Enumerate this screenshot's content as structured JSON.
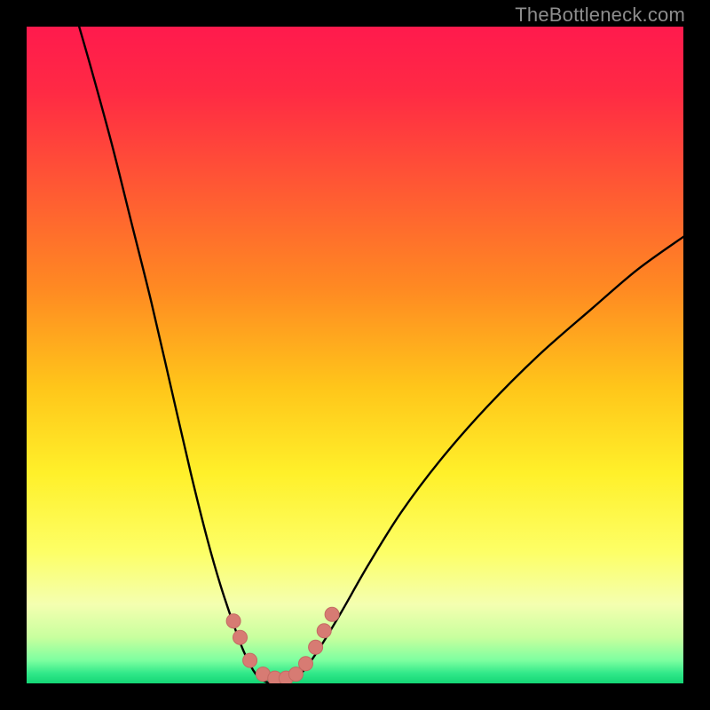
{
  "watermark": "TheBottleneck.com",
  "chart_data": {
    "type": "line",
    "title": "",
    "xlabel": "",
    "ylabel": "",
    "xlim": [
      0,
      100
    ],
    "ylim": [
      0,
      100
    ],
    "gradient_stops": [
      {
        "pos": 0.0,
        "color": "#ff1a4d"
      },
      {
        "pos": 0.1,
        "color": "#ff2a44"
      },
      {
        "pos": 0.25,
        "color": "#ff5a33"
      },
      {
        "pos": 0.4,
        "color": "#ff8a22"
      },
      {
        "pos": 0.55,
        "color": "#ffc61a"
      },
      {
        "pos": 0.68,
        "color": "#fff02a"
      },
      {
        "pos": 0.8,
        "color": "#fdff66"
      },
      {
        "pos": 0.88,
        "color": "#f4ffb0"
      },
      {
        "pos": 0.93,
        "color": "#c8ff9e"
      },
      {
        "pos": 0.965,
        "color": "#7dffa0"
      },
      {
        "pos": 0.985,
        "color": "#30e889"
      },
      {
        "pos": 1.0,
        "color": "#14d675"
      }
    ],
    "series": [
      {
        "name": "left_curve",
        "x": [
          8,
          10,
          13,
          16,
          19,
          22,
          25,
          27.5,
          29.5,
          31.5,
          33,
          34.5,
          35.5,
          36.5
        ],
        "y": [
          100,
          93,
          82,
          70,
          58,
          45,
          32,
          22,
          15,
          9,
          5,
          2,
          0.8,
          0.2
        ]
      },
      {
        "name": "right_curve",
        "x": [
          40,
          41.5,
          43,
          45,
          48,
          52,
          57,
          63,
          70,
          78,
          86,
          93,
          100
        ],
        "y": [
          0.2,
          1.2,
          3,
          6,
          11,
          18,
          26,
          34,
          42,
          50,
          57,
          63,
          68
        ]
      },
      {
        "name": "valley_floor",
        "x": [
          36.5,
          37.5,
          38.5,
          39.5,
          40.0
        ],
        "y": [
          0.2,
          0.0,
          0.0,
          0.0,
          0.2
        ]
      }
    ],
    "markers": [
      {
        "cx": 31.5,
        "cy": 9.5
      },
      {
        "cx": 32.5,
        "cy": 7.0
      },
      {
        "cx": 34.0,
        "cy": 3.5
      },
      {
        "cx": 36.0,
        "cy": 1.4
      },
      {
        "cx": 37.8,
        "cy": 0.8
      },
      {
        "cx": 39.5,
        "cy": 0.8
      },
      {
        "cx": 41.0,
        "cy": 1.4
      },
      {
        "cx": 42.5,
        "cy": 3.0
      },
      {
        "cx": 44.0,
        "cy": 5.5
      },
      {
        "cx": 45.3,
        "cy": 8.0
      },
      {
        "cx": 46.5,
        "cy": 10.5
      }
    ],
    "marker_style": {
      "r": 8,
      "fill": "#d77b73",
      "stroke": "#c46a63"
    }
  }
}
